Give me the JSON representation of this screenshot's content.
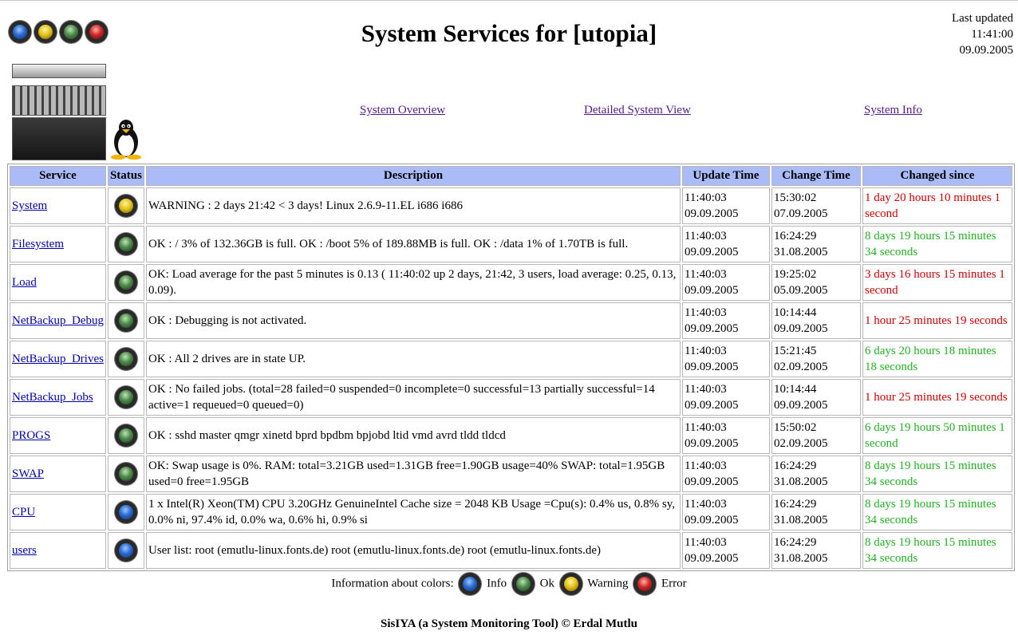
{
  "header": {
    "title": "System Services for [utopia]",
    "last_updated_label": "Last updated",
    "last_updated_time": "11:41:00",
    "last_updated_date": "09.09.2005"
  },
  "legend_top": [
    "info",
    "warning",
    "ok",
    "error"
  ],
  "nav": {
    "overview": "System Overview",
    "detailed": "Detailed System View",
    "info": "System Info"
  },
  "table": {
    "headers": [
      "Service",
      "Status",
      "Description",
      "Update Time",
      "Change Time",
      "Changed since"
    ],
    "rows": [
      {
        "service": "System",
        "status": "warning",
        "description": "WARNING : 2 days 21:42 < 3 days! Linux 2.6.9-11.EL i686 i686",
        "update_time": "11:40:03",
        "update_date": "09.09.2005",
        "change_time": "15:30:02",
        "change_date": "07.09.2005",
        "changed_since": "1 day 20 hours 10 minutes 1 second",
        "changed_color": "#cc0000"
      },
      {
        "service": "Filesystem",
        "status": "ok",
        "description": "OK : / 3% of 132.36GB is full. OK : /boot 5% of 189.88MB is full. OK : /data 1% of 1.70TB is full.",
        "update_time": "11:40:03",
        "update_date": "09.09.2005",
        "change_time": "16:24:29",
        "change_date": "31.08.2005",
        "changed_since": "8 days 19 hours 15 minutes 34 seconds",
        "changed_color": "#22b022"
      },
      {
        "service": "Load",
        "status": "ok",
        "description": "OK: Load average for the past 5 minutes is 0.13 ( 11:40:02 up 2 days, 21:42, 3 users, load average: 0.25, 0.13, 0.09).",
        "update_time": "11:40:03",
        "update_date": "09.09.2005",
        "change_time": "19:25:02",
        "change_date": "05.09.2005",
        "changed_since": "3 days 16 hours 15 minutes 1 second",
        "changed_color": "#cc0000"
      },
      {
        "service": "NetBackup_Debug",
        "status": "ok",
        "description": "OK : Debugging is not activated.",
        "update_time": "11:40:03",
        "update_date": "09.09.2005",
        "change_time": "10:14:44",
        "change_date": "09.09.2005",
        "changed_since": "1 hour 25 minutes 19 seconds",
        "changed_color": "#cc0000"
      },
      {
        "service": "NetBackup_Drives",
        "status": "ok",
        "description": "OK : All 2 drives are in state UP.",
        "update_time": "11:40:03",
        "update_date": "09.09.2005",
        "change_time": "15:21:45",
        "change_date": "02.09.2005",
        "changed_since": "6 days 20 hours 18 minutes 18 seconds",
        "changed_color": "#22b022"
      },
      {
        "service": "NetBackup_Jobs",
        "status": "ok",
        "description": "OK : No failed jobs. (total=28 failed=0 suspended=0 incomplete=0 successful=13 partially successful=14 active=1 requeued=0 queued=0)",
        "update_time": "11:40:03",
        "update_date": "09.09.2005",
        "change_time": "10:14:44",
        "change_date": "09.09.2005",
        "changed_since": "1 hour 25 minutes 19 seconds",
        "changed_color": "#cc0000"
      },
      {
        "service": "PROGS",
        "status": "ok",
        "description": "OK : sshd master qmgr xinetd bprd bpdbm bpjobd ltid vmd avrd tldd tldcd",
        "update_time": "11:40:03",
        "update_date": "09.09.2005",
        "change_time": "15:50:02",
        "change_date": "02.09.2005",
        "changed_since": "6 days 19 hours 50 minutes 1 second",
        "changed_color": "#22b022"
      },
      {
        "service": "SWAP",
        "status": "ok",
        "description": "OK: Swap usage is 0%. RAM: total=3.21GB used=1.31GB free=1.90GB usage=40% SWAP: total=1.95GB used=0 free=1.95GB",
        "update_time": "11:40:03",
        "update_date": "09.09.2005",
        "change_time": "16:24:29",
        "change_date": "31.08.2005",
        "changed_since": "8 days 19 hours 15 minutes 34 seconds",
        "changed_color": "#22b022"
      },
      {
        "service": "CPU",
        "status": "info",
        "description": "1 x Intel(R) Xeon(TM) CPU 3.20GHz GenuineIntel Cache size = 2048 KB Usage =Cpu(s): 0.4% us, 0.8% sy, 0.0% ni, 97.4% id, 0.0% wa, 0.6% hi, 0.9% si",
        "update_time": "11:40:03",
        "update_date": "09.09.2005",
        "change_time": "16:24:29",
        "change_date": "31.08.2005",
        "changed_since": "8 days 19 hours 15 minutes 34 seconds",
        "changed_color": "#22b022"
      },
      {
        "service": "users",
        "status": "info",
        "description": "User list: root (emutlu-linux.fonts.de) root (emutlu-linux.fonts.de) root (emutlu-linux.fonts.de)",
        "update_time": "11:40:03",
        "update_date": "09.09.2005",
        "change_time": "16:24:29",
        "change_date": "31.08.2005",
        "changed_since": "8 days 19 hours 15 minutes 34 seconds",
        "changed_color": "#22b022"
      }
    ]
  },
  "legend": {
    "label": "Information about colors:",
    "info": "Info",
    "ok": "Ok",
    "warning": "Warning",
    "error": "Error"
  },
  "footer": "SisIYA (a System Monitoring Tool) © Erdal Mutlu",
  "colors": {
    "header_bg": "#aabbf7",
    "changed_recent": "#cc0000",
    "changed_old": "#22b022",
    "link": "#0000aa",
    "visited_link": "#551a8b"
  }
}
